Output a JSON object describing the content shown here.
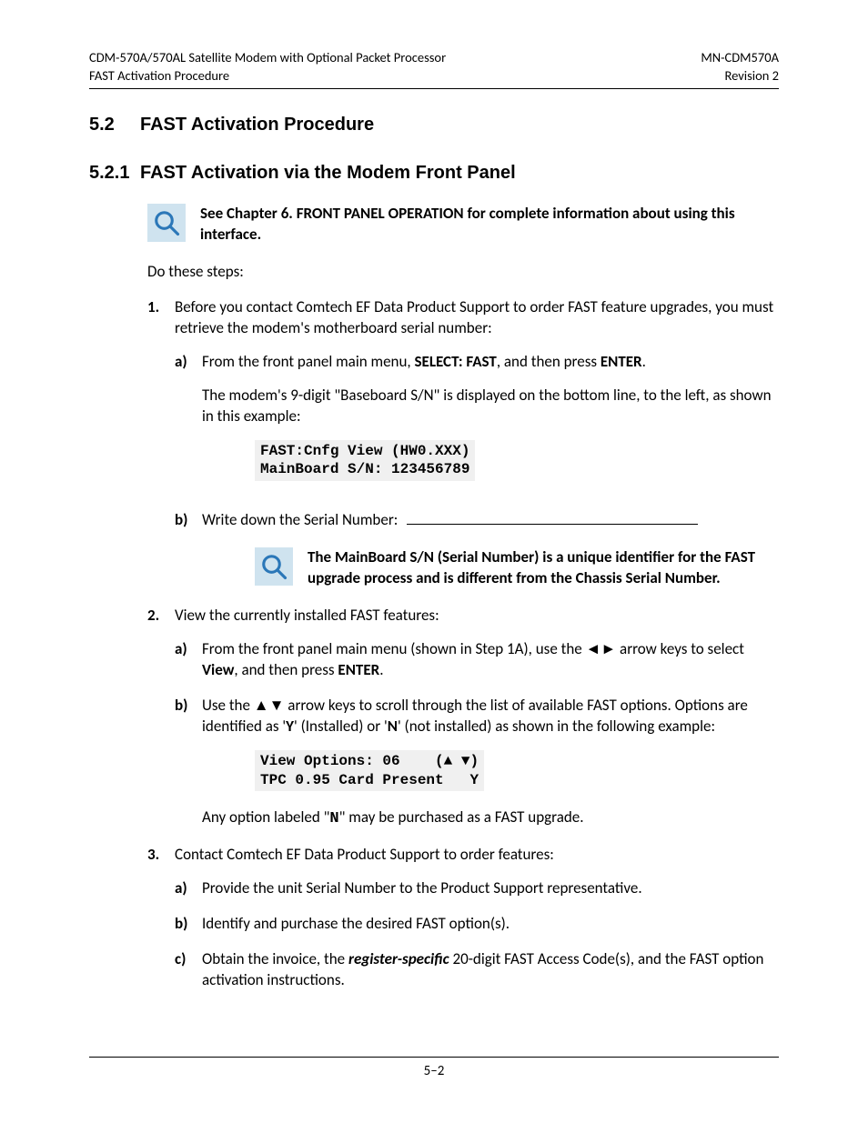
{
  "header": {
    "left_line1": "CDM-570A/570AL Satellite Modem with Optional Packet Processor",
    "left_line2": "FAST Activation Procedure",
    "right_line1": "MN-CDM570A",
    "right_line2": "Revision 2"
  },
  "section": {
    "num": "5.2",
    "title": "FAST Activation Procedure"
  },
  "subsection": {
    "num": "5.2.1",
    "title": "FAST Activation via the Modem Front Panel"
  },
  "note1": "See Chapter 6. FRONT PANEL OPERATION for complete information about using this interface.",
  "intro": "Do these steps:",
  "steps": {
    "s1": {
      "text": "Before you contact Comtech EF Data Product Support to order FAST feature upgrades, you must retrieve the modem's motherboard serial number:",
      "a": {
        "pre": "From the front panel main menu, ",
        "bold1": "SELECT: FAST",
        "mid": ", and then press ",
        "bold2": "ENTER",
        "post": ".",
        "para2": "The modem's 9-digit \"Baseboard S/N\" is displayed on the bottom line, to the left, as shown in this example:",
        "code": "FAST:Cnfg View (HW0.XXX)\nMainBoard S/N: 123456789"
      },
      "b": {
        "text": "Write down the Serial Number:",
        "note": "The MainBoard S/N (Serial Number) is a unique identifier for the FAST upgrade process and is different from the Chassis Serial Number."
      }
    },
    "s2": {
      "text": "View the currently installed FAST features:",
      "a": {
        "pre": "From the front panel main menu (shown in Step 1A), use the ",
        "arrows": "◄►",
        "mid": " arrow keys to select ",
        "bold1": "View",
        "mid2": ", and then press ",
        "bold2": "ENTER",
        "post": "."
      },
      "b": {
        "pre": "Use the ",
        "arrows": "▲▼",
        "mid": " arrow keys to scroll through the list of available FAST options. Options are identified as '",
        "boldY": "Y",
        "mid2": "' (Installed) or '",
        "boldN": "N",
        "post": "' (not installed) as shown in the following example:",
        "code": "View Options: 06    (▲ ▼)\nTPC 0.95 Card Present   Y",
        "tail_pre": "Any option labeled \"",
        "tail_mono": "N",
        "tail_post": "\" may be purchased as a FAST upgrade."
      }
    },
    "s3": {
      "text": "Contact Comtech EF Data Product Support to order features:",
      "a": "Provide the unit Serial Number to the Product Support representative.",
      "b": "Identify and purchase the desired FAST option(s).",
      "c": {
        "pre": "Obtain the invoice, the ",
        "ital": "register-specific",
        "post": " 20-digit FAST Access Code(s), and the FAST option activation instructions."
      }
    }
  },
  "footer": "5–2"
}
